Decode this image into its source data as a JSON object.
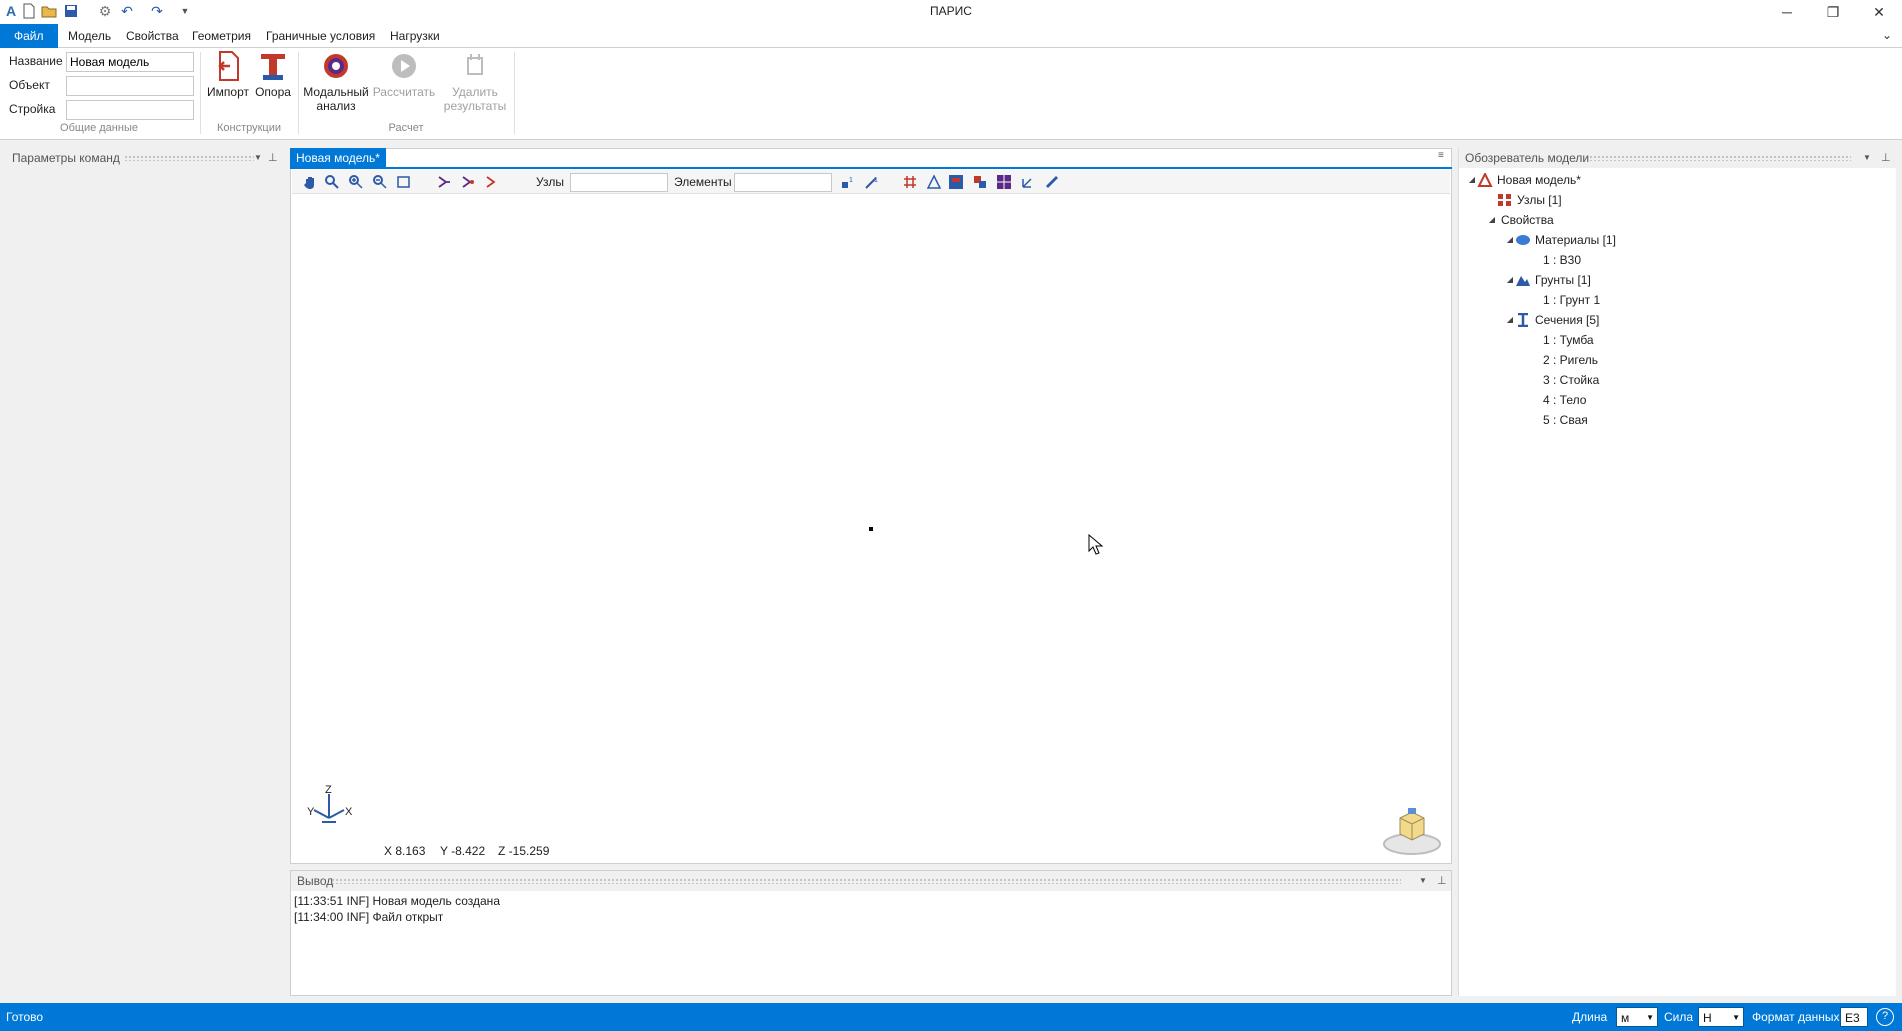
{
  "window": {
    "title": "ПАРИС"
  },
  "menu": {
    "file": "Файл",
    "items": [
      "Модель",
      "Свойства",
      "Геометрия",
      "Граничные условия",
      "Нагрузки"
    ]
  },
  "ribbon": {
    "general": {
      "fields": [
        {
          "label": "Название",
          "value": "Новая модель"
        },
        {
          "label": "Объект",
          "value": ""
        },
        {
          "label": "Стройка",
          "value": ""
        }
      ],
      "group_label": "Общие данные"
    },
    "constructions": {
      "import_label": "Импорт",
      "support_label": "Опора",
      "group_label": "Конструкции"
    },
    "calc": {
      "modal_label_1": "Модальный",
      "modal_label_2": "анализ",
      "calculate_label": "Рассчитать",
      "delete_label_1": "Удалить",
      "delete_label_2": "результаты",
      "group_label": "Расчет"
    }
  },
  "left_panel": {
    "title": "Параметры команд"
  },
  "document": {
    "tab_label": "Новая модель*",
    "toolbar": {
      "nodes_label": "Узлы",
      "nodes_value": "",
      "elements_label": "Элементы",
      "elements_value": ""
    },
    "axis": {
      "z": "Z",
      "y": "Y",
      "x": "X"
    },
    "coords": {
      "x": "X 8.163",
      "y": "Y -8.422",
      "z": "Z -15.259"
    }
  },
  "output": {
    "title": "Вывод",
    "lines": [
      "[11:33:51 INF] Новая модель создана",
      "[11:34:00 INF] Файл открыт"
    ]
  },
  "explorer": {
    "title": "Обозреватель модели",
    "root": "Новая модель*",
    "nodes": "Узлы [1]",
    "properties": "Свойства",
    "materials": "Материалы [1]",
    "material_items": [
      "1 : B30"
    ],
    "soils": "Грунты [1]",
    "soil_items": [
      "1 : Грунт 1"
    ],
    "sections": "Сечения [5]",
    "section_items": [
      "1 : Тумба",
      "2 : Ригель",
      "3 : Стойка",
      "4 : Тело",
      "5 : Свая"
    ]
  },
  "statusbar": {
    "status": "Готово",
    "length_label": "Длина",
    "length_value": "м",
    "force_label": "Сила",
    "force_value": "Н",
    "format_label": "Формат данных",
    "format_value": "E3"
  },
  "colors": {
    "accent": "#0078d7",
    "brand_red": "#c0392b"
  }
}
